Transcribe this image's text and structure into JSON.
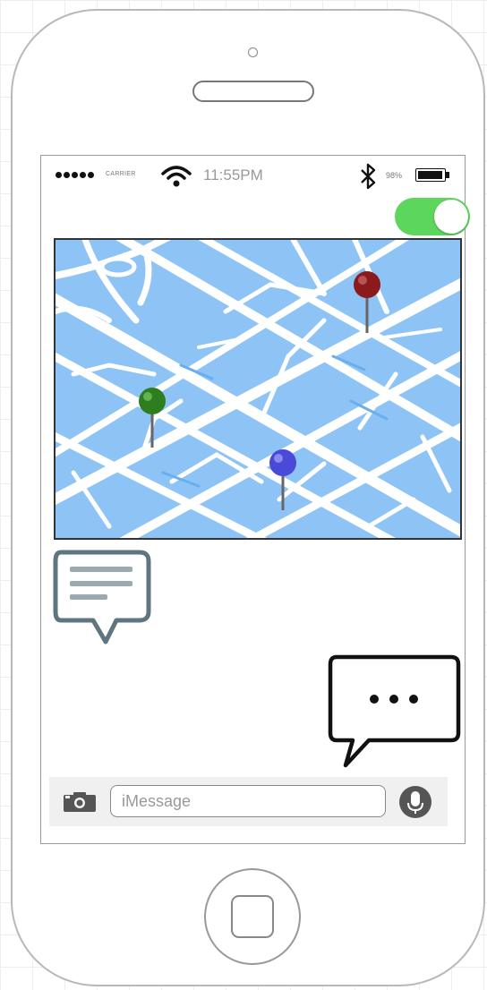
{
  "status_bar": {
    "carrier": "CARRIER",
    "time": "11:55PM",
    "battery": "98%",
    "battery_level": 0.98,
    "icons": [
      "signal-dots-icon",
      "wifi-icon",
      "bluetooth-icon",
      "battery-icon"
    ]
  },
  "toggle": {
    "on": true,
    "color": "#5cd65c"
  },
  "map": {
    "icons": [
      "map-pin-red-icon",
      "map-pin-green-icon",
      "map-pin-blue-icon"
    ],
    "colors": {
      "water": "#8ec4f5",
      "road": "#ffffff",
      "pin_red": "#8b1a1a",
      "pin_green": "#2e7d1e",
      "pin_blue": "#4a4ad8"
    }
  },
  "chat": {
    "icons": [
      "message-bubble-icon",
      "typing-bubble-icon"
    ]
  },
  "input_bar": {
    "placeholder": "iMessage",
    "value": "",
    "icons": [
      "camera-icon",
      "microphone-icon"
    ]
  }
}
